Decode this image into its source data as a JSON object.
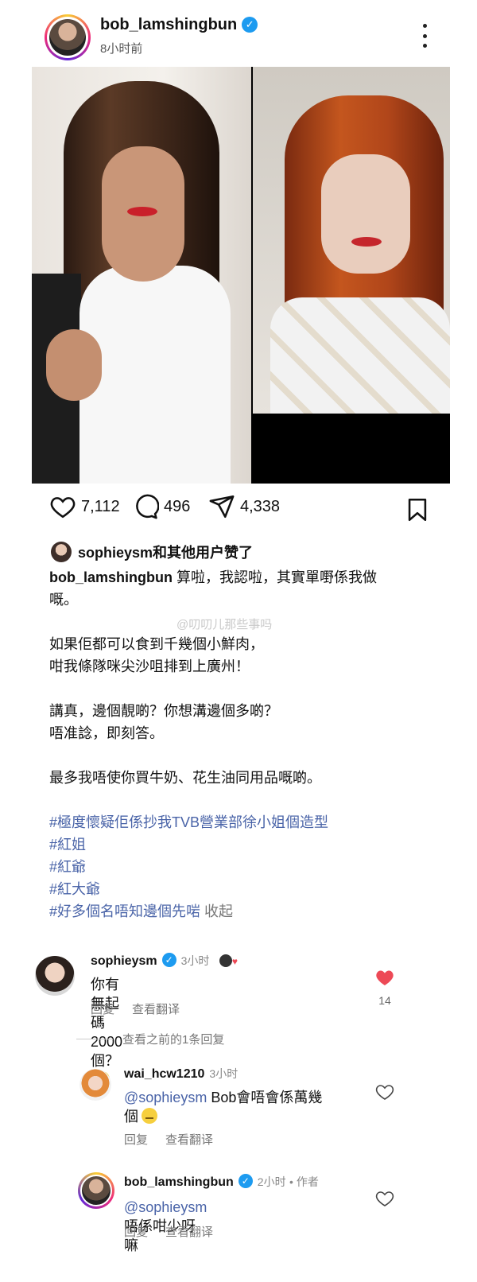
{
  "post": {
    "username": "bob_lamshingbun",
    "time": "8小时前"
  },
  "actions": {
    "likes": "7,112",
    "comments": "496",
    "shares": "4,338"
  },
  "liked_by": "sophieysm和其他用户赞了",
  "caption": {
    "user": "bob_lamshingbun",
    "line1": " 算啦，我認啦，其實單嘢係我做",
    "line2": "嘅。",
    "para2_l1": "如果佢都可以食到千幾個小鮮肉，",
    "para2_l2": "咁我條隊咪尖沙咀排到上廣州！",
    "para3_l1": "講真，邊個靚啲？你想溝邊個多啲？",
    "para3_l2": "唔准諗，即刻答。",
    "para4": "最多我唔使你買牛奶、花生油同用品嘅啲。",
    "hashtags": [
      "#極度懷疑佢係抄我TVB營業部徐小姐個造型",
      "#紅姐",
      "#紅爺",
      "#紅大爺",
      "#好多個名唔知邊個先啱"
    ],
    "collapse": "收起"
  },
  "watermark": "@叨叨儿那些事吗",
  "comments": [
    {
      "user": "sophieysm",
      "time": "3小时",
      "text": "你有無起碼2000個？",
      "reply": "回复",
      "translate": "查看翻译",
      "likes": "14"
    }
  ],
  "view_previous": "查看之前的1条回复",
  "replies": [
    {
      "user": "wai_hcw1210",
      "time": "3小时",
      "mention": "@sophieysm",
      "text_l1": " Bob會唔會係萬幾",
      "text_l2": "個",
      "reply": "回复",
      "translate": "查看翻译"
    },
    {
      "user": "bob_lamshingbun",
      "time": "2小时",
      "author": "• 作者",
      "mention": "@sophieysm",
      "text": " 唔係咁少呀嘛",
      "reply": "回复",
      "translate": "查看翻译"
    }
  ],
  "colors": {
    "like_red": "#ed4956",
    "hashtag": "#4a64a8",
    "verified": "#1d9bf0"
  }
}
